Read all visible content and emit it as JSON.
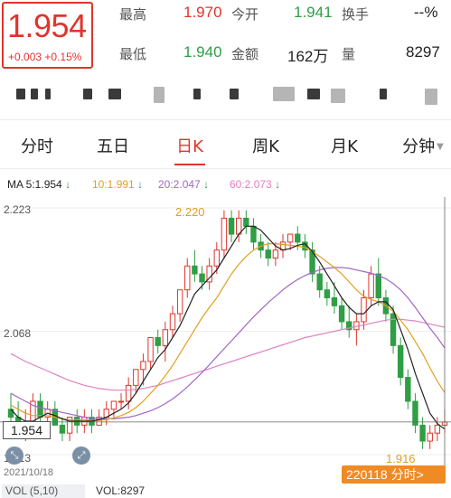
{
  "quote": {
    "price": "1.954",
    "change": "+0.003",
    "change_pct": "+0.15%",
    "fields": {
      "high_label": "最高",
      "high_value": "1.970",
      "open_label": "今开",
      "open_value": "1.941",
      "turnover_label": "换手",
      "turnover_value": "--%",
      "low_label": "最低",
      "low_value": "1.940",
      "amount_label": "金额",
      "amount_value": "162万",
      "volume_label": "量",
      "volume_value": "8297"
    }
  },
  "tabs": [
    {
      "label": "分时"
    },
    {
      "label": "五日"
    },
    {
      "label": "日K",
      "active": true
    },
    {
      "label": "周K"
    },
    {
      "label": "月K"
    },
    {
      "label": "分钟"
    }
  ],
  "ma": {
    "ma5": "MA 5:1.954",
    "ma10": "10:1.991",
    "ma20": "20:2.047",
    "ma60": "60:2.073",
    "arrow": "↓"
  },
  "colors": {
    "up": "#e0342c",
    "down": "#2f9e44",
    "ma5": "#222222",
    "ma10": "#e0a020",
    "ma20": "#a066c8",
    "ma60": "#e080c0",
    "date_tag": "#f08a24"
  },
  "chart": {
    "axis_max": "2.223",
    "axis_mid": "2.068",
    "axis_min_partial": "1.913",
    "crosshair_value": "1.954",
    "high_marker": "2.220",
    "low_marker": "1.916",
    "start_date": "2021/10/18",
    "crosshair_date": "220118 分时>"
  },
  "chart_data": {
    "type": "candlestick",
    "y_range": [
      1.913,
      2.223
    ],
    "ohlc": [
      [
        1.97,
        1.99,
        1.95,
        1.96
      ],
      [
        1.96,
        1.98,
        1.94,
        1.94
      ],
      [
        1.94,
        1.97,
        1.93,
        1.95
      ],
      [
        1.95,
        1.99,
        1.95,
        1.98
      ],
      [
        1.98,
        1.99,
        1.95,
        1.96
      ],
      [
        1.96,
        1.98,
        1.95,
        1.97
      ],
      [
        1.97,
        1.98,
        1.95,
        1.95
      ],
      [
        1.95,
        1.96,
        1.93,
        1.94
      ],
      [
        1.94,
        1.96,
        1.93,
        1.96
      ],
      [
        1.96,
        1.97,
        1.94,
        1.95
      ],
      [
        1.95,
        1.97,
        1.94,
        1.96
      ],
      [
        1.96,
        1.97,
        1.94,
        1.95
      ],
      [
        1.95,
        1.97,
        1.95,
        1.96
      ],
      [
        1.96,
        1.98,
        1.95,
        1.97
      ],
      [
        1.97,
        1.98,
        1.96,
        1.98
      ],
      [
        1.98,
        1.99,
        1.97,
        1.98
      ],
      [
        1.98,
        2.01,
        1.97,
        2.0
      ],
      [
        2.0,
        2.02,
        1.99,
        2.02
      ],
      [
        2.02,
        2.04,
        2.0,
        2.03
      ],
      [
        2.03,
        2.06,
        2.02,
        2.06
      ],
      [
        2.06,
        2.07,
        2.04,
        2.05
      ],
      [
        2.05,
        2.08,
        2.03,
        2.07
      ],
      [
        2.07,
        2.1,
        2.06,
        2.09
      ],
      [
        2.09,
        2.12,
        2.08,
        2.12
      ],
      [
        2.12,
        2.16,
        2.11,
        2.15
      ],
      [
        2.15,
        2.17,
        2.13,
        2.14
      ],
      [
        2.14,
        2.15,
        2.12,
        2.13
      ],
      [
        2.13,
        2.16,
        2.12,
        2.15
      ],
      [
        2.15,
        2.18,
        2.14,
        2.17
      ],
      [
        2.17,
        2.22,
        2.16,
        2.21
      ],
      [
        2.21,
        2.22,
        2.18,
        2.19
      ],
      [
        2.19,
        2.22,
        2.18,
        2.21
      ],
      [
        2.21,
        2.22,
        2.19,
        2.2
      ],
      [
        2.2,
        2.21,
        2.17,
        2.18
      ],
      [
        2.18,
        2.19,
        2.16,
        2.17
      ],
      [
        2.17,
        2.18,
        2.15,
        2.16
      ],
      [
        2.16,
        2.18,
        2.15,
        2.17
      ],
      [
        2.17,
        2.19,
        2.16,
        2.18
      ],
      [
        2.18,
        2.19,
        2.17,
        2.19
      ],
      [
        2.19,
        2.2,
        2.17,
        2.18
      ],
      [
        2.18,
        2.19,
        2.16,
        2.17
      ],
      [
        2.17,
        2.18,
        2.13,
        2.14
      ],
      [
        2.14,
        2.15,
        2.11,
        2.12
      ],
      [
        2.12,
        2.13,
        2.1,
        2.11
      ],
      [
        2.11,
        2.13,
        2.09,
        2.1
      ],
      [
        2.1,
        2.11,
        2.07,
        2.08
      ],
      [
        2.08,
        2.1,
        2.06,
        2.07
      ],
      [
        2.07,
        2.09,
        2.05,
        2.08
      ],
      [
        2.08,
        2.12,
        2.07,
        2.11
      ],
      [
        2.11,
        2.15,
        2.1,
        2.14
      ],
      [
        2.14,
        2.16,
        2.1,
        2.11
      ],
      [
        2.11,
        2.12,
        2.08,
        2.09
      ],
      [
        2.09,
        2.1,
        2.04,
        2.05
      ],
      [
        2.05,
        2.06,
        2.0,
        2.01
      ],
      [
        2.01,
        2.02,
        1.97,
        1.98
      ],
      [
        1.98,
        1.99,
        1.94,
        1.95
      ],
      [
        1.95,
        1.96,
        1.92,
        1.93
      ],
      [
        1.93,
        1.95,
        1.92,
        1.94
      ],
      [
        1.94,
        1.96,
        1.93,
        1.95
      ],
      [
        1.95,
        1.97,
        1.94,
        1.954
      ]
    ],
    "ma5": [
      1.97,
      1.96,
      1.955,
      1.955,
      1.96,
      1.965,
      1.962,
      1.958,
      1.955,
      1.955,
      1.955,
      1.955,
      1.957,
      1.96,
      1.965,
      1.97,
      1.978,
      1.99,
      2.005,
      2.02,
      2.035,
      2.045,
      2.06,
      2.075,
      2.095,
      2.115,
      2.125,
      2.135,
      2.145,
      2.16,
      2.175,
      2.19,
      2.2,
      2.2,
      2.195,
      2.185,
      2.175,
      2.17,
      2.172,
      2.176,
      2.178,
      2.168,
      2.155,
      2.14,
      2.125,
      2.11,
      2.098,
      2.09,
      2.09,
      2.1,
      2.105,
      2.105,
      2.095,
      2.07,
      2.045,
      2.015,
      1.99,
      1.965,
      1.952,
      1.945
    ],
    "ma10": [
      1.975,
      1.97,
      1.965,
      1.962,
      1.962,
      1.962,
      1.96,
      1.958,
      1.957,
      1.957,
      1.957,
      1.956,
      1.956,
      1.957,
      1.959,
      1.962,
      1.966,
      1.972,
      1.98,
      1.99,
      2.0,
      2.012,
      2.025,
      2.04,
      2.055,
      2.07,
      2.085,
      2.098,
      2.11,
      2.125,
      2.14,
      2.152,
      2.162,
      2.17,
      2.175,
      2.178,
      2.178,
      2.177,
      2.176,
      2.175,
      2.173,
      2.168,
      2.162,
      2.155,
      2.148,
      2.14,
      2.13,
      2.12,
      2.112,
      2.108,
      2.105,
      2.1,
      2.093,
      2.082,
      2.07,
      2.055,
      2.04,
      2.022,
      2.005,
      1.991
    ],
    "ma20": [
      1.99,
      1.985,
      1.98,
      1.975,
      1.972,
      1.97,
      1.968,
      1.966,
      1.964,
      1.962,
      1.96,
      1.959,
      1.958,
      1.958,
      1.958,
      1.959,
      1.96,
      1.962,
      1.965,
      1.968,
      1.972,
      1.977,
      1.983,
      1.99,
      1.998,
      2.007,
      2.016,
      2.026,
      2.036,
      2.046,
      2.056,
      2.066,
      2.076,
      2.086,
      2.095,
      2.104,
      2.112,
      2.12,
      2.127,
      2.133,
      2.138,
      2.142,
      2.145,
      2.147,
      2.148,
      2.148,
      2.147,
      2.145,
      2.143,
      2.141,
      2.138,
      2.134,
      2.128,
      2.12,
      2.11,
      2.098,
      2.085,
      2.072,
      2.06,
      2.047
    ],
    "ma60": [
      2.04,
      2.035,
      2.03,
      2.026,
      2.022,
      2.018,
      2.014,
      2.01,
      2.006,
      2.003,
      2.0,
      1.998,
      1.996,
      1.995,
      1.994,
      1.994,
      1.994,
      1.995,
      1.996,
      1.998,
      2.0,
      2.003,
      2.006,
      2.009,
      2.012,
      2.015,
      2.018,
      2.021,
      2.024,
      2.027,
      2.03,
      2.033,
      2.036,
      2.039,
      2.042,
      2.045,
      2.048,
      2.051,
      2.054,
      2.057,
      2.06,
      2.062,
      2.064,
      2.066,
      2.068,
      2.07,
      2.072,
      2.074,
      2.076,
      2.078,
      2.08,
      2.082,
      2.083,
      2.083,
      2.082,
      2.081,
      2.079,
      2.077,
      2.075,
      2.073
    ]
  },
  "bottom": {
    "vol_select": "VOL (5,10)",
    "vol_value": "VOL:8297"
  }
}
